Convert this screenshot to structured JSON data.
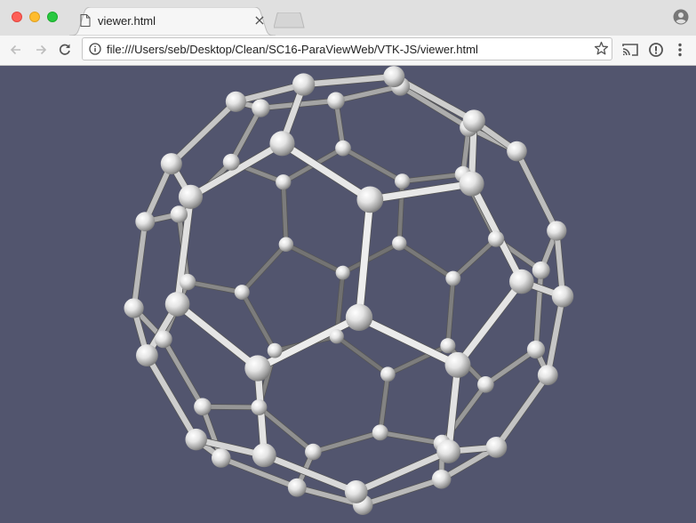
{
  "window": {
    "tab": {
      "title": "viewer.html",
      "close_icon": "close-icon",
      "doc_icon": "document-icon"
    },
    "profile_icon": "account-circle-icon"
  },
  "toolbar": {
    "back_icon": "arrow-left-icon",
    "forward_icon": "arrow-right-icon",
    "reload_icon": "reload-icon",
    "url": "file:///Users/seb/Desktop/Clean/SC16-ParaViewWeb/VTK-JS/viewer.html",
    "site_info_icon": "info-icon",
    "bookmark_icon": "star-icon",
    "cast_icon": "cast-icon",
    "extension_icon": "extension-info-icon",
    "menu_icon": "kebab-menu-icon"
  },
  "viewer": {
    "background_color": "#52556e",
    "molecule": "ball-and-stick C60 fullerene"
  }
}
